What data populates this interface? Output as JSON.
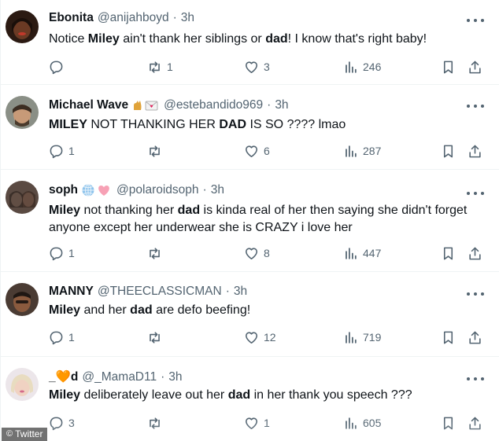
{
  "tweets": [
    {
      "name": "Ebonita",
      "emoji": "",
      "handle": "@anijahboyd",
      "dot": "·",
      "time": "3h",
      "text": [
        {
          "t": "Notice ",
          "b": false
        },
        {
          "t": "Miley",
          "b": true
        },
        {
          "t": " ain't thank her siblings or ",
          "b": false
        },
        {
          "t": "dad",
          "b": true
        },
        {
          "t": "! I know that's right baby!",
          "b": false
        }
      ],
      "reply_count": "",
      "retweet_count": "1",
      "like_count": "3",
      "view_count": "246"
    },
    {
      "name": "Michael Wave",
      "emoji": "🐈 💌",
      "handle": "@estebandido969",
      "dot": "·",
      "time": "3h",
      "text": [
        {
          "t": "MILEY",
          "b": true
        },
        {
          "t": " NOT THANKING HER ",
          "b": false
        },
        {
          "t": "DAD",
          "b": true
        },
        {
          "t": " IS SO ???? lmao",
          "b": false
        }
      ],
      "reply_count": "1",
      "retweet_count": "",
      "like_count": "6",
      "view_count": "287"
    },
    {
      "name": "soph",
      "emoji": "🌐 🩷",
      "handle": "@polaroidsoph",
      "dot": "·",
      "time": "3h",
      "text": [
        {
          "t": "Miley",
          "b": true
        },
        {
          "t": " not thanking her ",
          "b": false
        },
        {
          "t": "dad",
          "b": true
        },
        {
          "t": " is kinda real of her then saying she didn't forget anyone except her underwear she is CRAZY i love her",
          "b": false
        }
      ],
      "reply_count": "1",
      "retweet_count": "",
      "like_count": "8",
      "view_count": "447"
    },
    {
      "name": "MANNY",
      "emoji": "",
      "handle": "@THEECLASSICMAN",
      "dot": "·",
      "time": "3h",
      "text": [
        {
          "t": "Miley",
          "b": true
        },
        {
          "t": " and her ",
          "b": false
        },
        {
          "t": "dad",
          "b": true
        },
        {
          "t": " are defo beefing!",
          "b": false
        }
      ],
      "reply_count": "1",
      "retweet_count": "",
      "like_count": "12",
      "view_count": "719"
    },
    {
      "name": "_🧡d",
      "emoji": "",
      "handle": "@_MamaD11",
      "dot": "·",
      "time": "3h",
      "text": [
        {
          "t": "Miley",
          "b": true
        },
        {
          "t": " deliberately leave out her ",
          "b": false
        },
        {
          "t": "dad",
          "b": true
        },
        {
          "t": " in her thank you speech ???",
          "b": false
        }
      ],
      "reply_count": "3",
      "retweet_count": "",
      "like_count": "1",
      "view_count": "605"
    }
  ],
  "watermark": {
    "symbol": "©",
    "label": "Twitter"
  },
  "colors": {
    "text": "#0f1419",
    "muted": "#536471",
    "divider": "#eff3f4"
  },
  "icons": [
    "reply-icon",
    "retweet-icon",
    "like-icon",
    "views-icon",
    "bookmark-icon",
    "share-icon",
    "more-icon"
  ]
}
